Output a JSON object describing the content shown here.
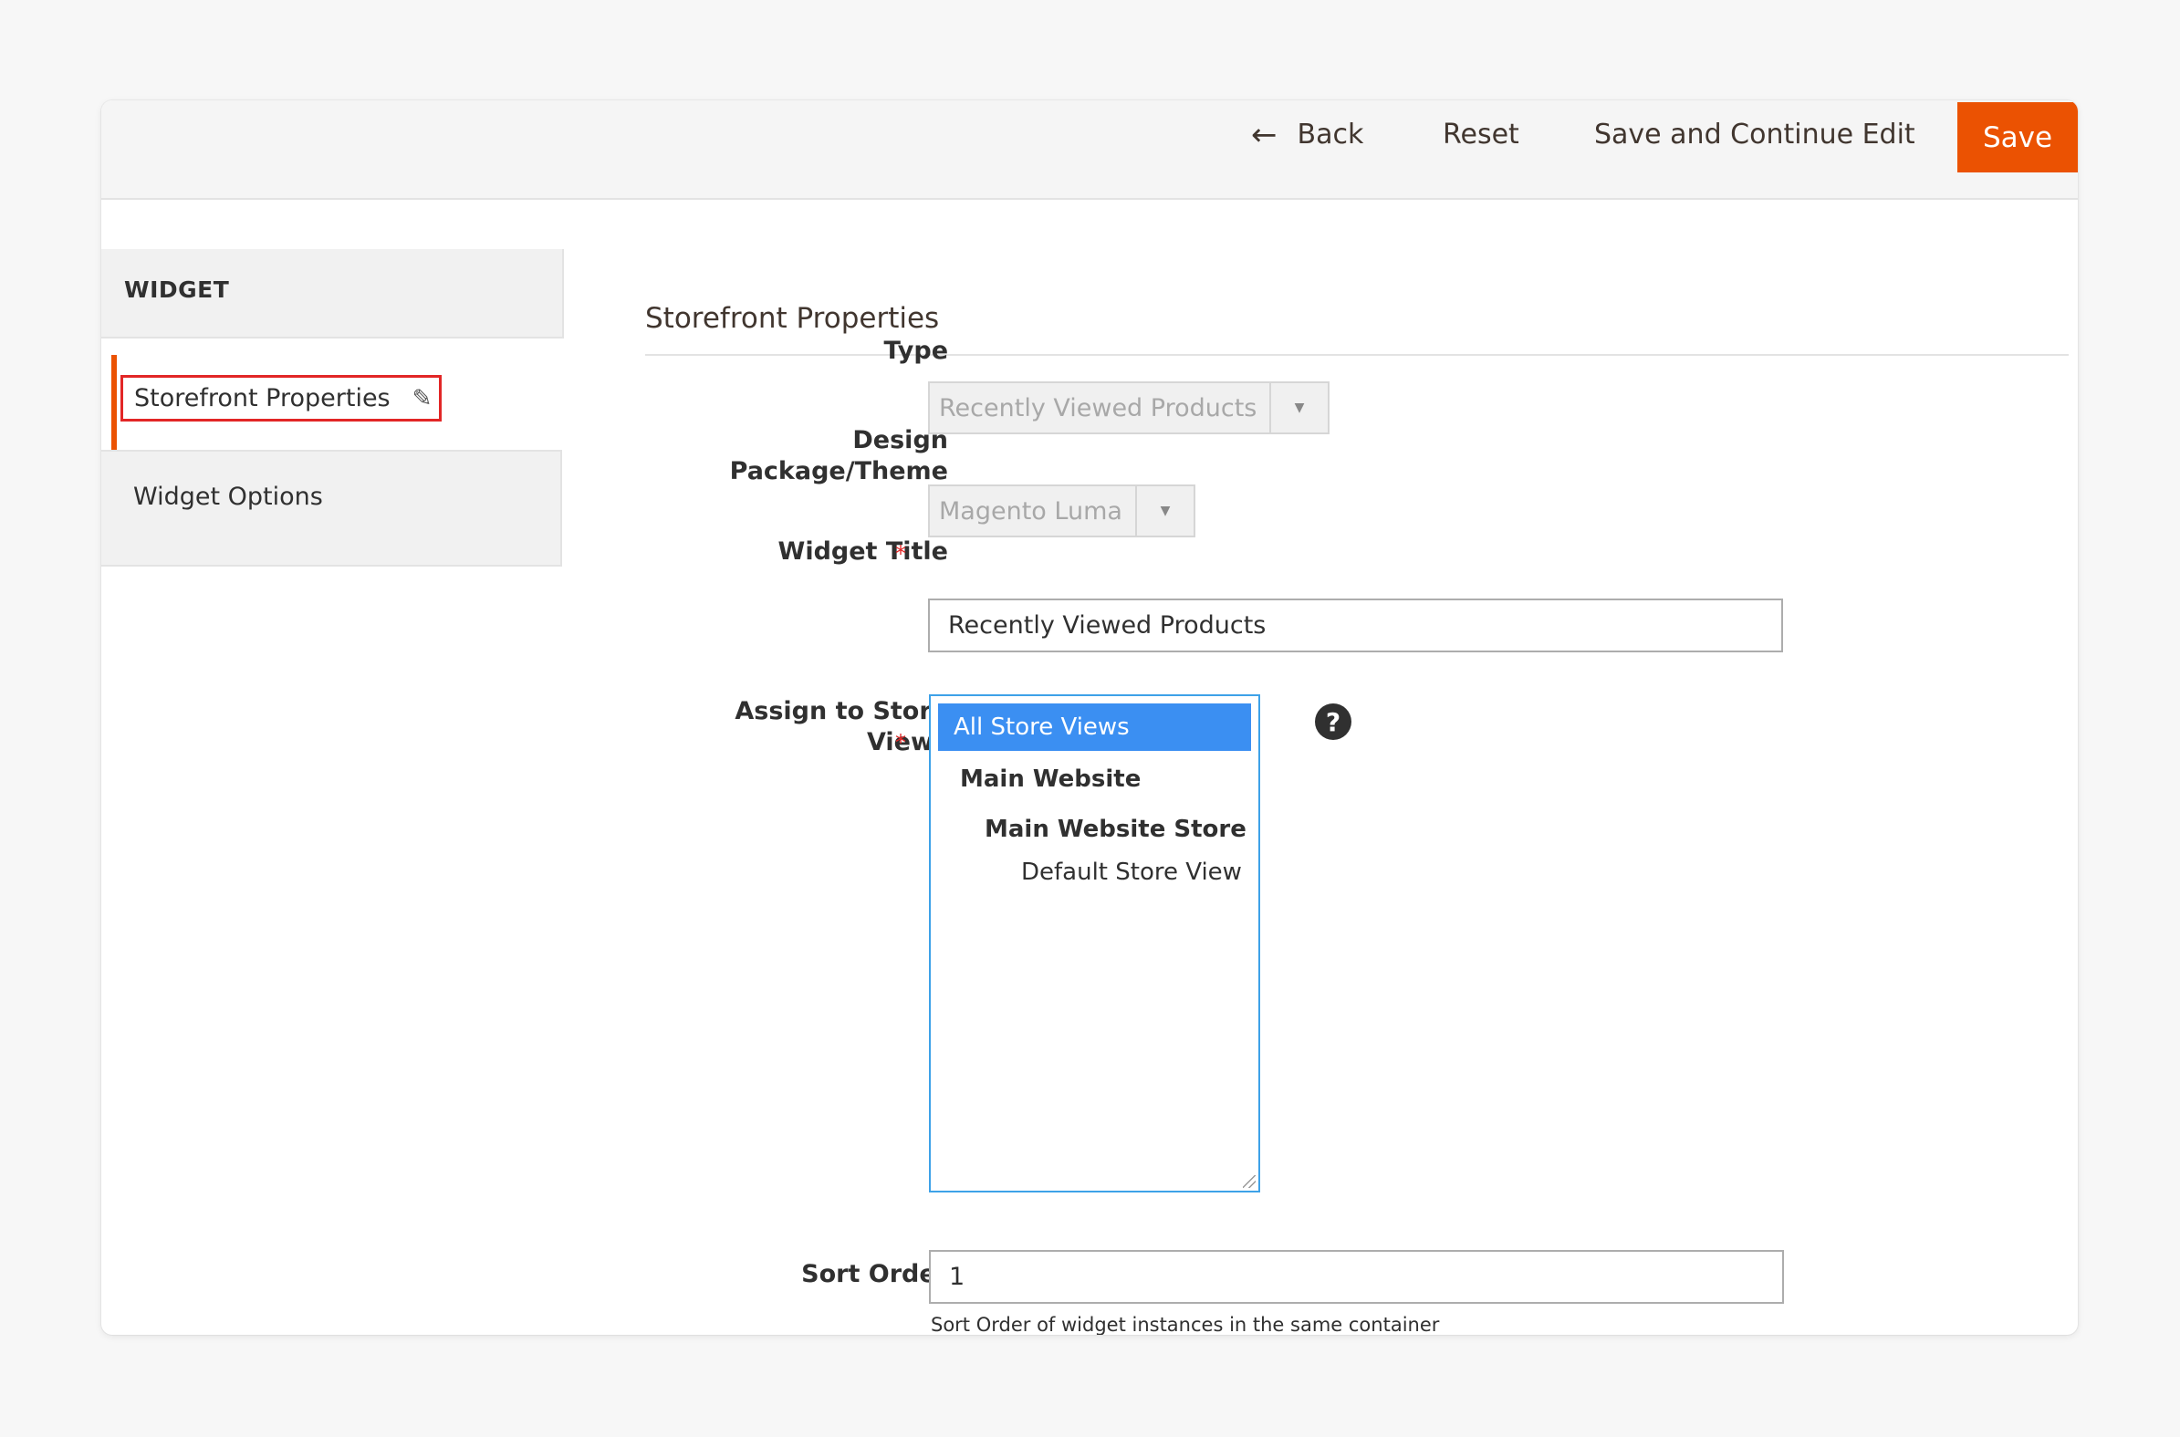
{
  "toolbar": {
    "back_label": "Back",
    "reset_label": "Reset",
    "save_continue_label": "Save and Continue Edit",
    "save_label": "Save"
  },
  "sidebar": {
    "header": "WIDGET",
    "items": [
      {
        "label": "Storefront Properties",
        "active": true
      },
      {
        "label": "Widget Options",
        "active": false
      }
    ]
  },
  "section": {
    "title": "Storefront Properties"
  },
  "form": {
    "type": {
      "label": "Type",
      "value": "Recently Viewed Products",
      "disabled": true
    },
    "design": {
      "label_line1": "Design",
      "label_line2": "Package/Theme",
      "value": "Magento Luma",
      "disabled": true
    },
    "widget_title": {
      "label": "Widget Title",
      "required": "*",
      "value": "Recently Viewed Products"
    },
    "store_views": {
      "label_line1": "Assign to Store",
      "label_line2": "Views",
      "required": "*",
      "options": {
        "selected": "All Store Views",
        "group1": "Main Website",
        "group2": "Main Website Store",
        "leaf": "Default Store View"
      }
    },
    "sort_order": {
      "label": "Sort Order",
      "value": "1",
      "note": "Sort Order of widget instances in the same container"
    }
  },
  "colors": {
    "accent": "#eb5202",
    "selected_option": "#3b8ff2",
    "required": "#e22626",
    "highlight_box": "#e22626"
  }
}
